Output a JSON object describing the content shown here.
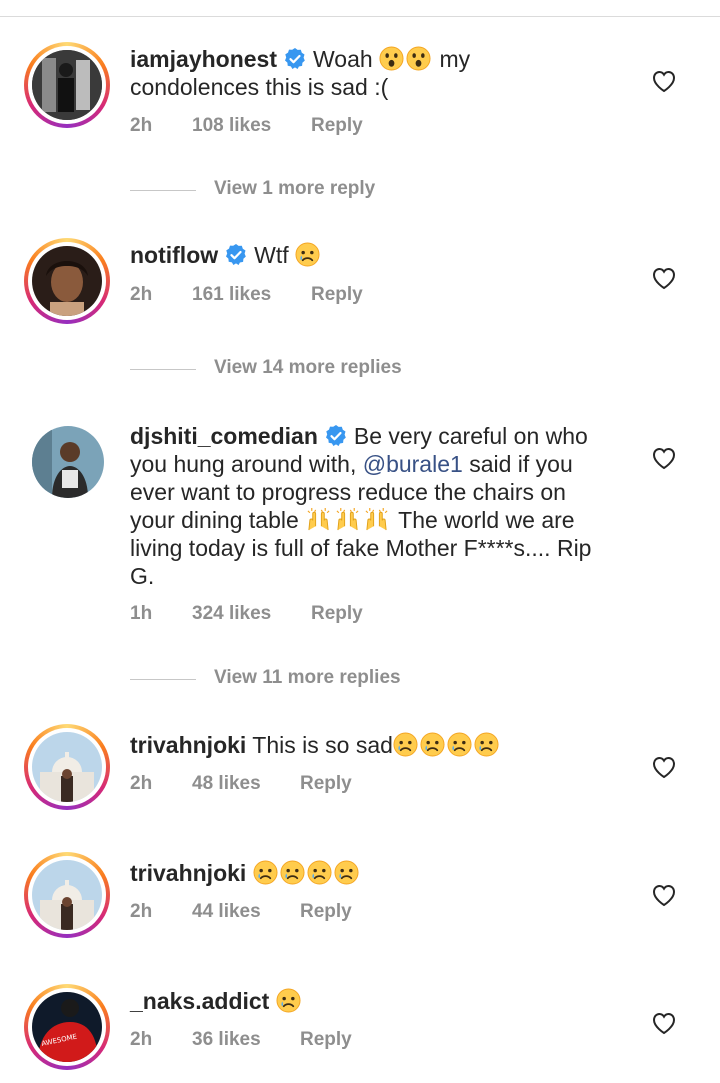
{
  "comments": [
    {
      "username": "iamjayhonest",
      "verified": true,
      "text_line1": "Woah",
      "text_line1b": "my",
      "text_line2": "condolences this is sad :(",
      "time": "2h",
      "likes": "108 likes",
      "reply": "Reply",
      "more_replies": "View 1 more reply"
    },
    {
      "username": "notiflow",
      "verified": true,
      "text": "Wtf",
      "time": "2h",
      "likes": "161 likes",
      "reply": "Reply",
      "more_replies": "View 14 more replies"
    },
    {
      "username": "djshiti_comedian",
      "verified": true,
      "text_a": "Be very careful on who",
      "text_b": "you hung around with,",
      "mention": "@burale1",
      "text_c": "said if you",
      "text_d": "ever want to progress reduce the chairs on",
      "text_e": "your dining table",
      "text_f": "The world we are",
      "text_g": "living today is full of fake Mother F****s.... Rip",
      "text_h": "G.",
      "time": "1h",
      "likes": "324 likes",
      "reply": "Reply",
      "more_replies": "View 11 more replies"
    },
    {
      "username": "trivahnjoki",
      "verified": false,
      "text": "This is so sad",
      "time": "2h",
      "likes": "48 likes",
      "reply": "Reply"
    },
    {
      "username": "trivahnjoki",
      "verified": false,
      "text": "",
      "time": "2h",
      "likes": "44 likes",
      "reply": "Reply"
    },
    {
      "username": "_naks.addict",
      "verified": false,
      "text": "",
      "time": "2h",
      "likes": "36 likes",
      "reply": "Reply"
    }
  ],
  "colors": {
    "text": "#262626",
    "meta": "#8e8e8e",
    "mention": "#385185",
    "verified": "#3897f0"
  },
  "icons": [
    "heart-outline-icon",
    "verified-badge-icon",
    "sad-emoji-icon",
    "surprised-emoji-icon",
    "raised-hands-emoji-icon"
  ]
}
